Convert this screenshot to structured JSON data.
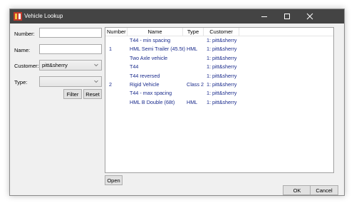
{
  "window": {
    "title": "Vehicle Lookup"
  },
  "filters": {
    "number_label": "Number:",
    "number_value": "",
    "name_label": "Name:",
    "name_value": "",
    "customer_label": "Customer:",
    "customer_value": "pitt&sherry",
    "type_label": "Type:",
    "type_value": "",
    "filter_button": "Filter",
    "reset_button": "Reset"
  },
  "table": {
    "columns": [
      "Number",
      "Name",
      "Type",
      "Customer"
    ],
    "rows": [
      {
        "number": "",
        "name": "T44 - min spacing",
        "type": "",
        "customer": "1: pitt&sherry"
      },
      {
        "number": "1",
        "name": "HML Semi Trailer (45.5t)",
        "type": "HML",
        "customer": "1: pitt&sherry"
      },
      {
        "number": "",
        "name": "Two Axle vehicle",
        "type": "",
        "customer": "1: pitt&sherry"
      },
      {
        "number": "",
        "name": "T44",
        "type": "",
        "customer": "1: pitt&sherry"
      },
      {
        "number": "",
        "name": "T44 reversed",
        "type": "",
        "customer": "1: pitt&sherry"
      },
      {
        "number": "2",
        "name": "Rigid Vehicle",
        "type": "Class 2",
        "customer": "1: pitt&sherry"
      },
      {
        "number": "",
        "name": "T44 - max spacing",
        "type": "",
        "customer": "1: pitt&sherry"
      },
      {
        "number": "",
        "name": "HML B Double (68t)",
        "type": "HML",
        "customer": "1: pitt&sherry"
      }
    ]
  },
  "footer": {
    "open_button": "Open",
    "ok_button": "OK",
    "cancel_button": "Cancel"
  },
  "colors": {
    "titlebar": "#444444",
    "row_text": "#1a2b8c",
    "window_bg": "#f0f0f0"
  },
  "icons": {
    "app": "vehicle-lookup-app-icon",
    "minimize": "minimize-icon",
    "maximize": "maximize-icon",
    "close": "close-icon"
  }
}
